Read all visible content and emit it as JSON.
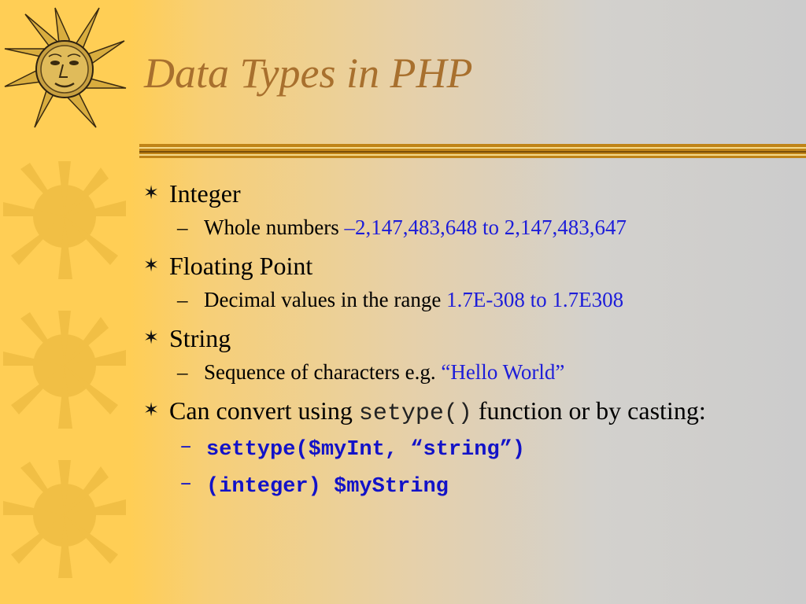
{
  "slide": {
    "title": "Data Types in PHP",
    "bullet_glyph": "✶",
    "dash_glyph": "–",
    "items": [
      {
        "label": "Integer",
        "sub": {
          "prefix": "Whole numbers ",
          "highlight": "–2,147,483,648 to 2,147,483,647"
        }
      },
      {
        "label": "Floating Point",
        "sub": {
          "prefix": "Decimal values in the range ",
          "highlight": "1.7E-308 to 1.7E308"
        }
      },
      {
        "label": "String",
        "sub": {
          "prefix": "Sequence of characters e.g. ",
          "highlight": "“Hello World”"
        }
      },
      {
        "label_prefix": "Can convert using ",
        "label_code": "setype()",
        "label_suffix": " function or by casting:",
        "code_lines": [
          "settype($myInt, “string”)",
          "(integer) $myString"
        ]
      }
    ]
  },
  "colors": {
    "sidebar": "#ffce55",
    "title": "#a8702e",
    "highlight": "#1d1dd9",
    "rule": "#c08417"
  },
  "icons": [
    "sun-face-icon",
    "sun-icon",
    "star-bullet-icon"
  ]
}
